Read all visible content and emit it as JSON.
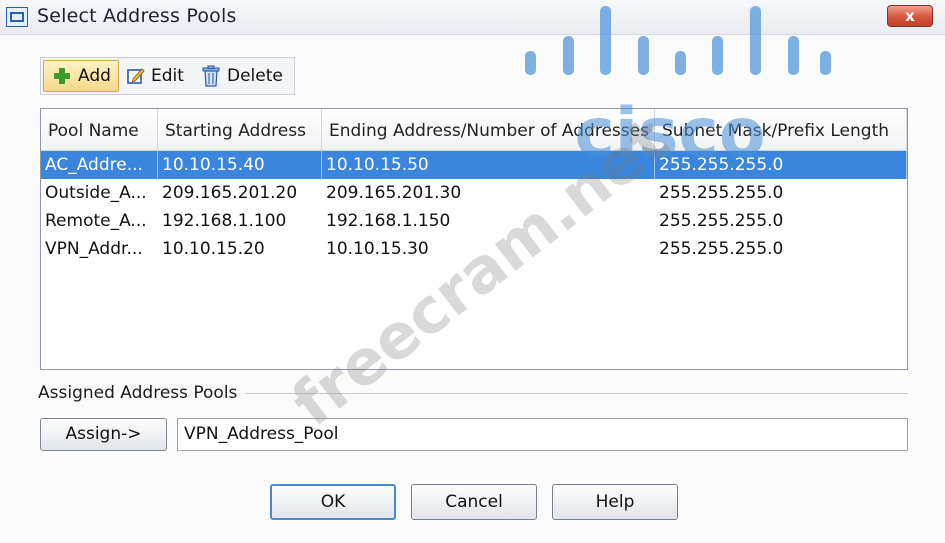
{
  "window": {
    "title": "Select Address Pools",
    "close_symbol": "x"
  },
  "toolbar": {
    "add_label": "Add",
    "edit_label": "Edit",
    "delete_label": "Delete"
  },
  "table": {
    "columns": [
      "Pool Name",
      "Starting Address",
      "Ending Address/Number of Addresses",
      "Subnet Mask/Prefix Length"
    ],
    "rows": [
      [
        "AC_Addre...",
        "10.10.15.40",
        "10.10.15.50",
        "255.255.255.0"
      ],
      [
        "Outside_A...",
        "209.165.201.20",
        "209.165.201.30",
        "255.255.255.0"
      ],
      [
        "Remote_A...",
        "192.168.1.100",
        "192.168.1.150",
        "255.255.255.0"
      ],
      [
        "VPN_Addr...",
        "10.10.15.20",
        "10.10.15.30",
        "255.255.255.0"
      ]
    ],
    "selected_row": 0
  },
  "assigned": {
    "section_label": "Assigned Address Pools",
    "assign_label": "Assign->",
    "value": "VPN_Address_Pool"
  },
  "buttons": {
    "ok": "OK",
    "cancel": "Cancel",
    "help": "Help"
  },
  "watermark": {
    "logo_text": "cisco",
    "site_text": "freecram.net"
  },
  "colors": {
    "selection": "#3a86df",
    "close_button": "#d5553d",
    "add_icon": "#3a9a2a",
    "logo_blue": "#4a90d9"
  },
  "icons": {
    "add": "plus-icon",
    "edit": "edit-icon",
    "delete": "trash-icon",
    "close": "close-icon"
  }
}
